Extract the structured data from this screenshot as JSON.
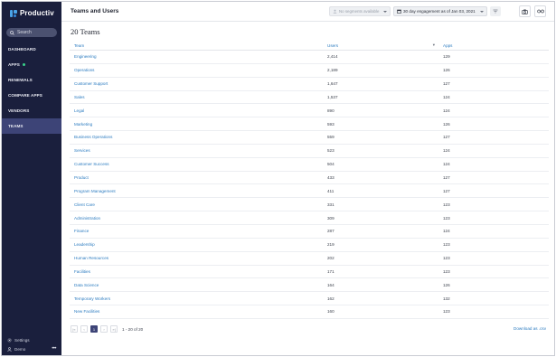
{
  "sidebar": {
    "logo": "Productiv",
    "search_label": "Search",
    "items": [
      {
        "label": "DASHBOARD"
      },
      {
        "label": "APPS"
      },
      {
        "label": "RENEWALS"
      },
      {
        "label": "COMPARE APPS"
      },
      {
        "label": "VENDORS"
      },
      {
        "label": "TEAMS"
      }
    ],
    "active": "TEAMS",
    "settings_label": "Settings",
    "user_label": "Demo",
    "more_label": "•••"
  },
  "header": {
    "title": "Teams and Users",
    "segments_placeholder": "No segments available",
    "date_range": "30 day engagement as of Jan 03, 2021"
  },
  "main": {
    "count_title": "20 Teams",
    "columns": {
      "team": "Team",
      "users": "Users",
      "apps": "Apps"
    },
    "sort_indicator": "▾",
    "rows": [
      {
        "team": "Engineering",
        "users": "2,414",
        "apps": "129"
      },
      {
        "team": "Operations",
        "users": "2,189",
        "apps": "126"
      },
      {
        "team": "Customer Support",
        "users": "1,647",
        "apps": "127"
      },
      {
        "team": "Sales",
        "users": "1,537",
        "apps": "124"
      },
      {
        "team": "Legal",
        "users": "890",
        "apps": "124"
      },
      {
        "team": "Marketing",
        "users": "593",
        "apps": "126"
      },
      {
        "team": "Business Operations",
        "users": "559",
        "apps": "127"
      },
      {
        "team": "Services",
        "users": "523",
        "apps": "124"
      },
      {
        "team": "Customer Success",
        "users": "504",
        "apps": "124"
      },
      {
        "team": "Product",
        "users": "433",
        "apps": "127"
      },
      {
        "team": "Program Management",
        "users": "411",
        "apps": "127"
      },
      {
        "team": "Client Care",
        "users": "331",
        "apps": "123"
      },
      {
        "team": "Administration",
        "users": "309",
        "apps": "123"
      },
      {
        "team": "Finance",
        "users": "287",
        "apps": "124"
      },
      {
        "team": "Leadership",
        "users": "219",
        "apps": "123"
      },
      {
        "team": "Human Resources",
        "users": "202",
        "apps": "123"
      },
      {
        "team": "Facilities",
        "users": "171",
        "apps": "123"
      },
      {
        "team": "Data Science",
        "users": "164",
        "apps": "126"
      },
      {
        "team": "Temporary Workers",
        "users": "162",
        "apps": "132"
      },
      {
        "team": "New Facilities",
        "users": "160",
        "apps": "123"
      }
    ],
    "pagination": {
      "first": "|«",
      "prev": "‹",
      "page": "1",
      "next": "›",
      "last": "»|",
      "range_text": "1 - 20 of 20"
    },
    "download_label": "Download as .csv"
  },
  "colors": {
    "sidebar_bg": "#1a1f3d",
    "active_nav": "#3d4477",
    "link": "#2b7bc0",
    "status_dot": "#39d08a"
  }
}
